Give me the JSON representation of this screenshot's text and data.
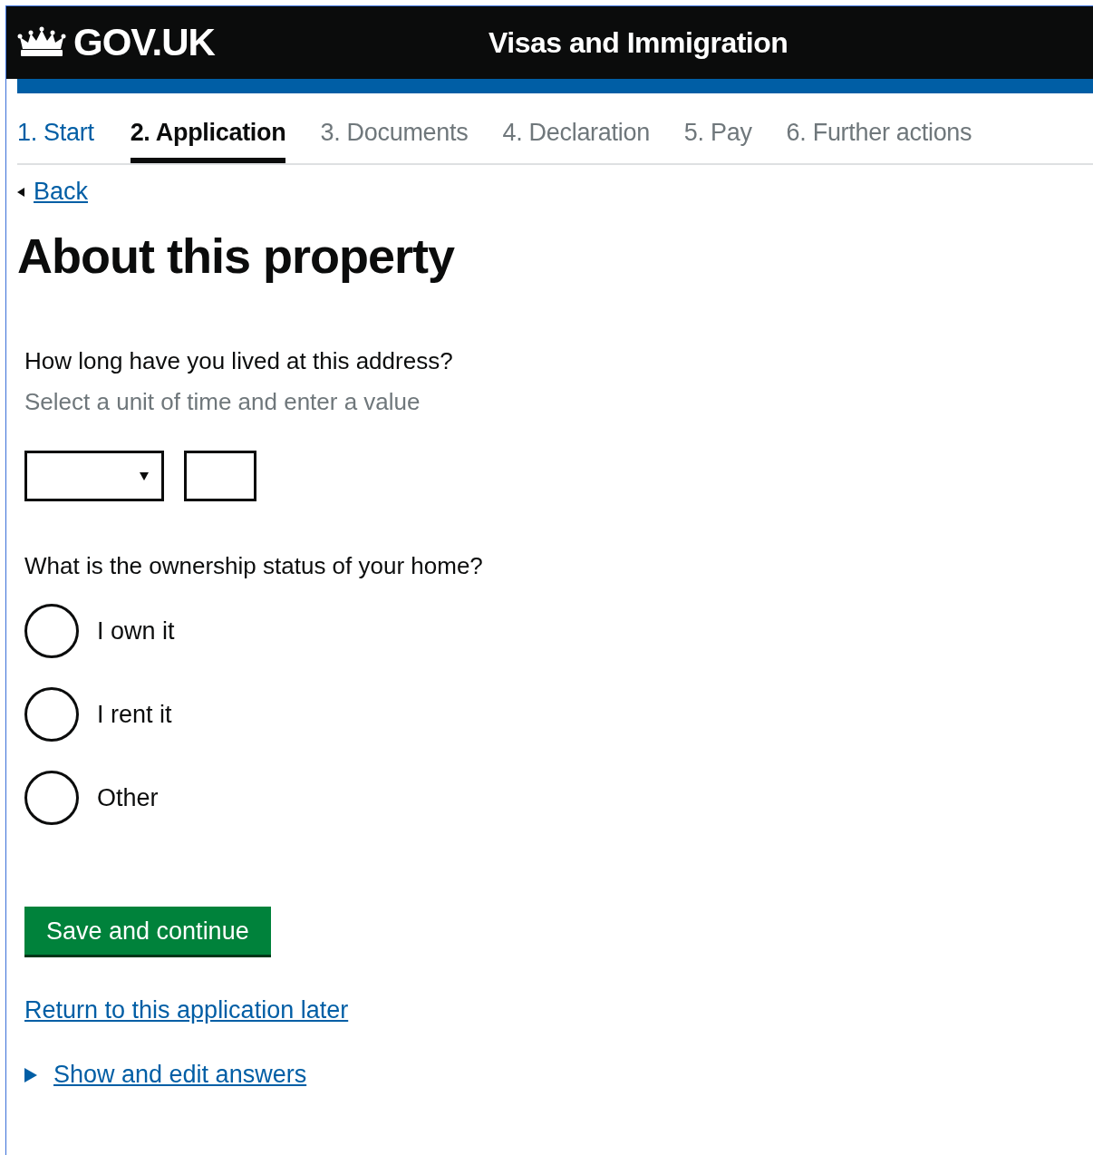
{
  "header": {
    "logo": "GOV.UK",
    "service": "Visas and Immigration"
  },
  "steps": [
    {
      "label": "1. Start",
      "selected": false,
      "completed": true
    },
    {
      "label": "2. Application",
      "selected": true,
      "completed": false
    },
    {
      "label": "3. Documents",
      "selected": false,
      "completed": false
    },
    {
      "label": "4. Declaration",
      "selected": false,
      "completed": false
    },
    {
      "label": "5. Pay",
      "selected": false,
      "completed": false
    },
    {
      "label": "6. Further actions",
      "selected": false,
      "completed": false
    }
  ],
  "back_link": "Back",
  "title": "About this property",
  "duration": {
    "question": "How long have you lived at this address?",
    "hint": "Select a unit of time and enter a value"
  },
  "ownership": {
    "question": "What is the ownership status of your home?",
    "options": [
      {
        "label": "I own it",
        "selected": false
      },
      {
        "label": "I rent it",
        "selected": false
      },
      {
        "label": "Other",
        "selected": false
      }
    ]
  },
  "save_button": "Save and continue",
  "return_link": "Return to this application later",
  "details_link": "Show and edit answers"
}
